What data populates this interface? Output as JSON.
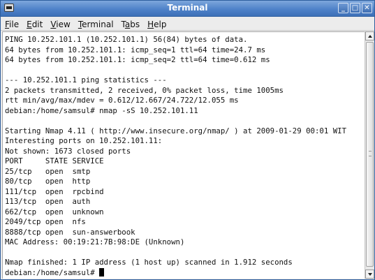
{
  "window": {
    "title": "Terminal",
    "icon": "terminal-icon",
    "controls": {
      "minimize": "minimize-icon",
      "maximize": "maximize-icon",
      "close": "close-icon"
    }
  },
  "menubar": {
    "items": [
      {
        "first": "F",
        "rest": "ile"
      },
      {
        "first": "E",
        "rest": "dit"
      },
      {
        "first": "V",
        "rest": "iew"
      },
      {
        "first": "T",
        "rest": "erminal"
      },
      {
        "first": "Ta",
        "rest": "bs",
        "underline_index": 1
      },
      {
        "first": "H",
        "rest": "elp"
      }
    ]
  },
  "terminal": {
    "lines": [
      "PING 10.252.101.1 (10.252.101.1) 56(84) bytes of data.",
      "64 bytes from 10.252.101.1: icmp_seq=1 ttl=64 time=24.7 ms",
      "64 bytes from 10.252.101.1: icmp_seq=2 ttl=64 time=0.612 ms",
      "",
      "--- 10.252.101.1 ping statistics ---",
      "2 packets transmitted, 2 received, 0% packet loss, time 1005ms",
      "rtt min/avg/max/mdev = 0.612/12.667/24.722/12.055 ms",
      "debian:/home/samsul# nmap -sS 10.252.101.11",
      "",
      "Starting Nmap 4.11 ( http://www.insecure.org/nmap/ ) at 2009-01-29 00:01 WIT",
      "Interesting ports on 10.252.101.11:",
      "Not shown: 1673 closed ports",
      "PORT     STATE SERVICE",
      "25/tcp   open  smtp",
      "80/tcp   open  http",
      "111/tcp  open  rpcbind",
      "113/tcp  open  auth",
      "662/tcp  open  unknown",
      "2049/tcp open  nfs",
      "8888/tcp open  sun-answerbook",
      "MAC Address: 00:19:21:7B:98:DE (Unknown)",
      "",
      "Nmap finished: 1 IP address (1 host up) scanned in 1.912 seconds"
    ],
    "prompt": "debian:/home/samsul# "
  },
  "colors": {
    "titlebar": "#4f82c9",
    "terminal_bg": "#ffffff",
    "text": "#111111"
  }
}
